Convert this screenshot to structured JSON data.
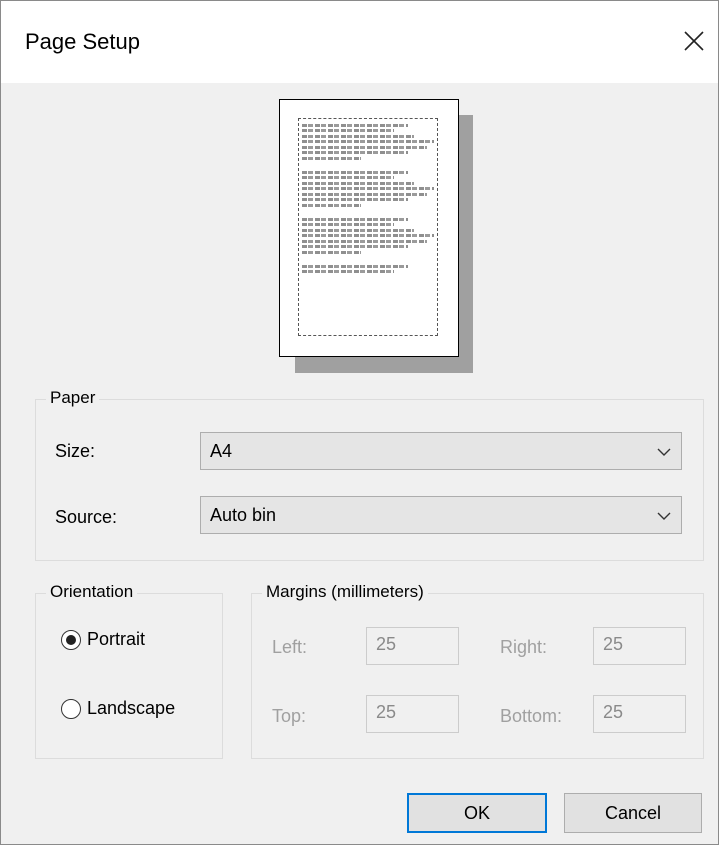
{
  "window": {
    "title": "Page Setup",
    "close_icon": "close-icon"
  },
  "paper": {
    "legend": "Paper",
    "size_label": "Size:",
    "size_value": "A4",
    "source_label": "Source:",
    "source_value": "Auto bin"
  },
  "orientation": {
    "legend": "Orientation",
    "portrait_label": "Portrait",
    "landscape_label": "Landscape",
    "selected": "Portrait"
  },
  "margins": {
    "legend": "Margins (millimeters)",
    "left_label": "Left:",
    "left_value": "25",
    "right_label": "Right:",
    "right_value": "25",
    "top_label": "Top:",
    "top_value": "25",
    "bottom_label": "Bottom:",
    "bottom_value": "25"
  },
  "buttons": {
    "ok": "OK",
    "cancel": "Cancel"
  },
  "colors": {
    "accent": "#0078d7"
  }
}
